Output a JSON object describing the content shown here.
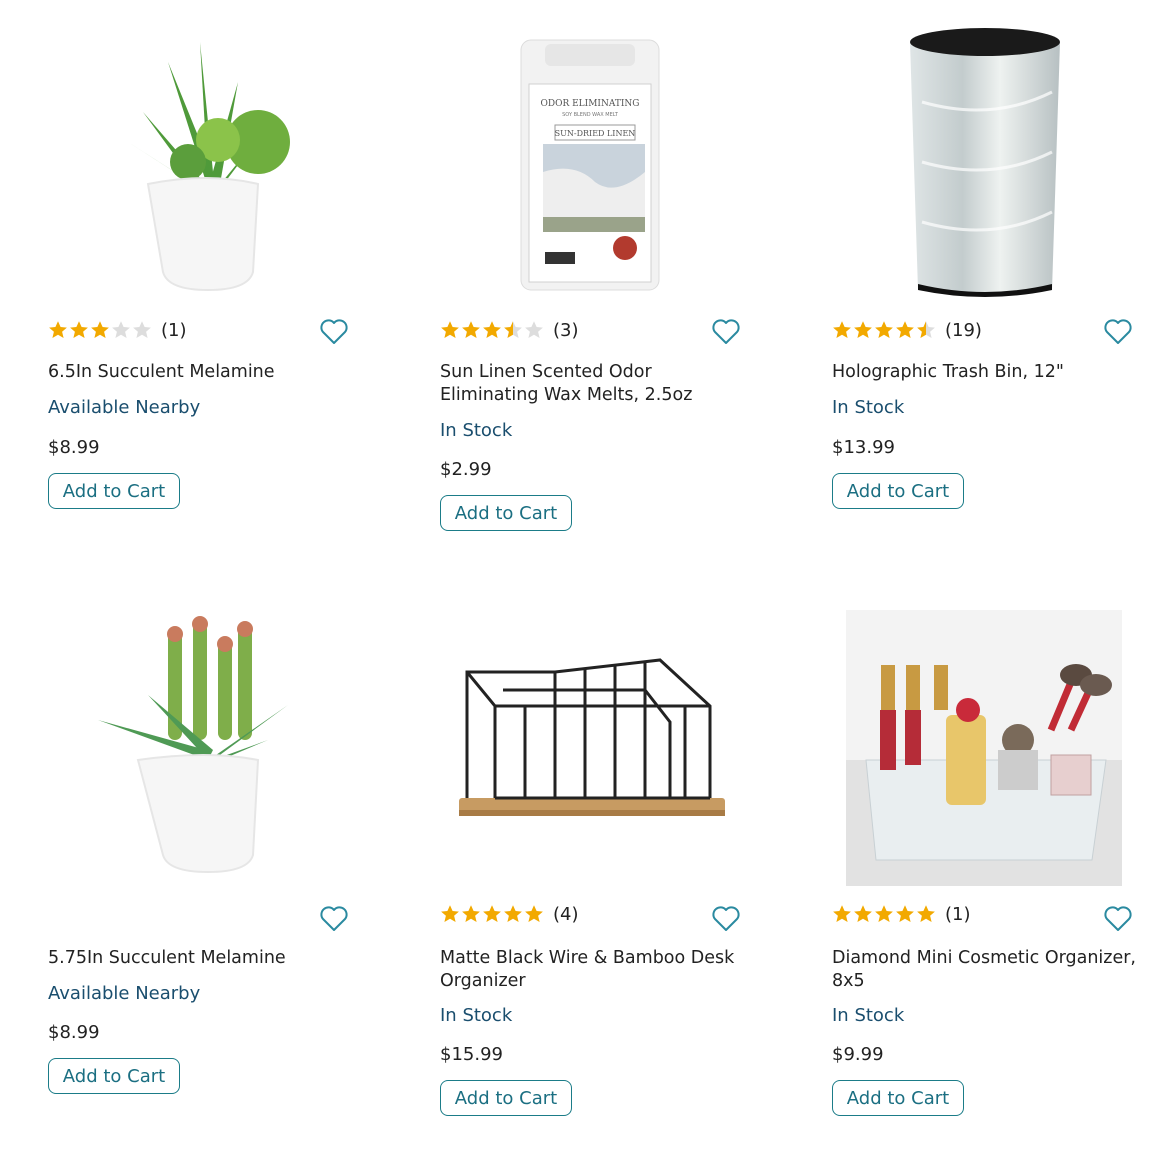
{
  "colors": {
    "accent": "#1b7c88",
    "star": "#f2a900",
    "star_empty": "#dddddd",
    "stock": "#1a4e6e"
  },
  "products": [
    {
      "title": "6.5In Succulent Melamine",
      "rating": 3,
      "review_count": "(1)",
      "stock": "Available Nearby",
      "price": "$8.99",
      "cart_label": "Add to Cart",
      "image_icon": "succulent-plant-icon"
    },
    {
      "title": "Sun Linen Scented Odor Eliminating Wax Melts, 2.5oz",
      "rating": 3.5,
      "review_count": "(3)",
      "stock": "In Stock",
      "price": "$2.99",
      "cart_label": "Add to Cart",
      "image_icon": "wax-melts-package-icon",
      "package_text": {
        "brand_line": "ODOR ELIMINATING",
        "sub_line": "SOY BLEND WAX MELT",
        "scent": "SUN-DRIED LINEN"
      }
    },
    {
      "title": "Holographic Trash Bin, 12\"",
      "rating": 4.5,
      "review_count": "(19)",
      "stock": "In Stock",
      "price": "$13.99",
      "cart_label": "Add to Cart",
      "image_icon": "holographic-bin-icon"
    },
    {
      "title": "5.75In Succulent Melamine",
      "rating": null,
      "review_count": "",
      "stock": "Available Nearby",
      "price": "$8.99",
      "cart_label": "Add to Cart",
      "image_icon": "succulent-plant-icon"
    },
    {
      "title": "Matte Black Wire & Bamboo Desk Organizer",
      "rating": 5,
      "review_count": "(4)",
      "stock": "In Stock",
      "price": "$15.99",
      "cart_label": "Add to Cart",
      "image_icon": "wire-desk-organizer-icon"
    },
    {
      "title": "Diamond Mini Cosmetic Organizer, 8x5",
      "rating": 5,
      "review_count": "(1)",
      "stock": "In Stock",
      "price": "$9.99",
      "cart_label": "Add to Cart",
      "image_icon": "cosmetic-organizer-icon"
    }
  ]
}
